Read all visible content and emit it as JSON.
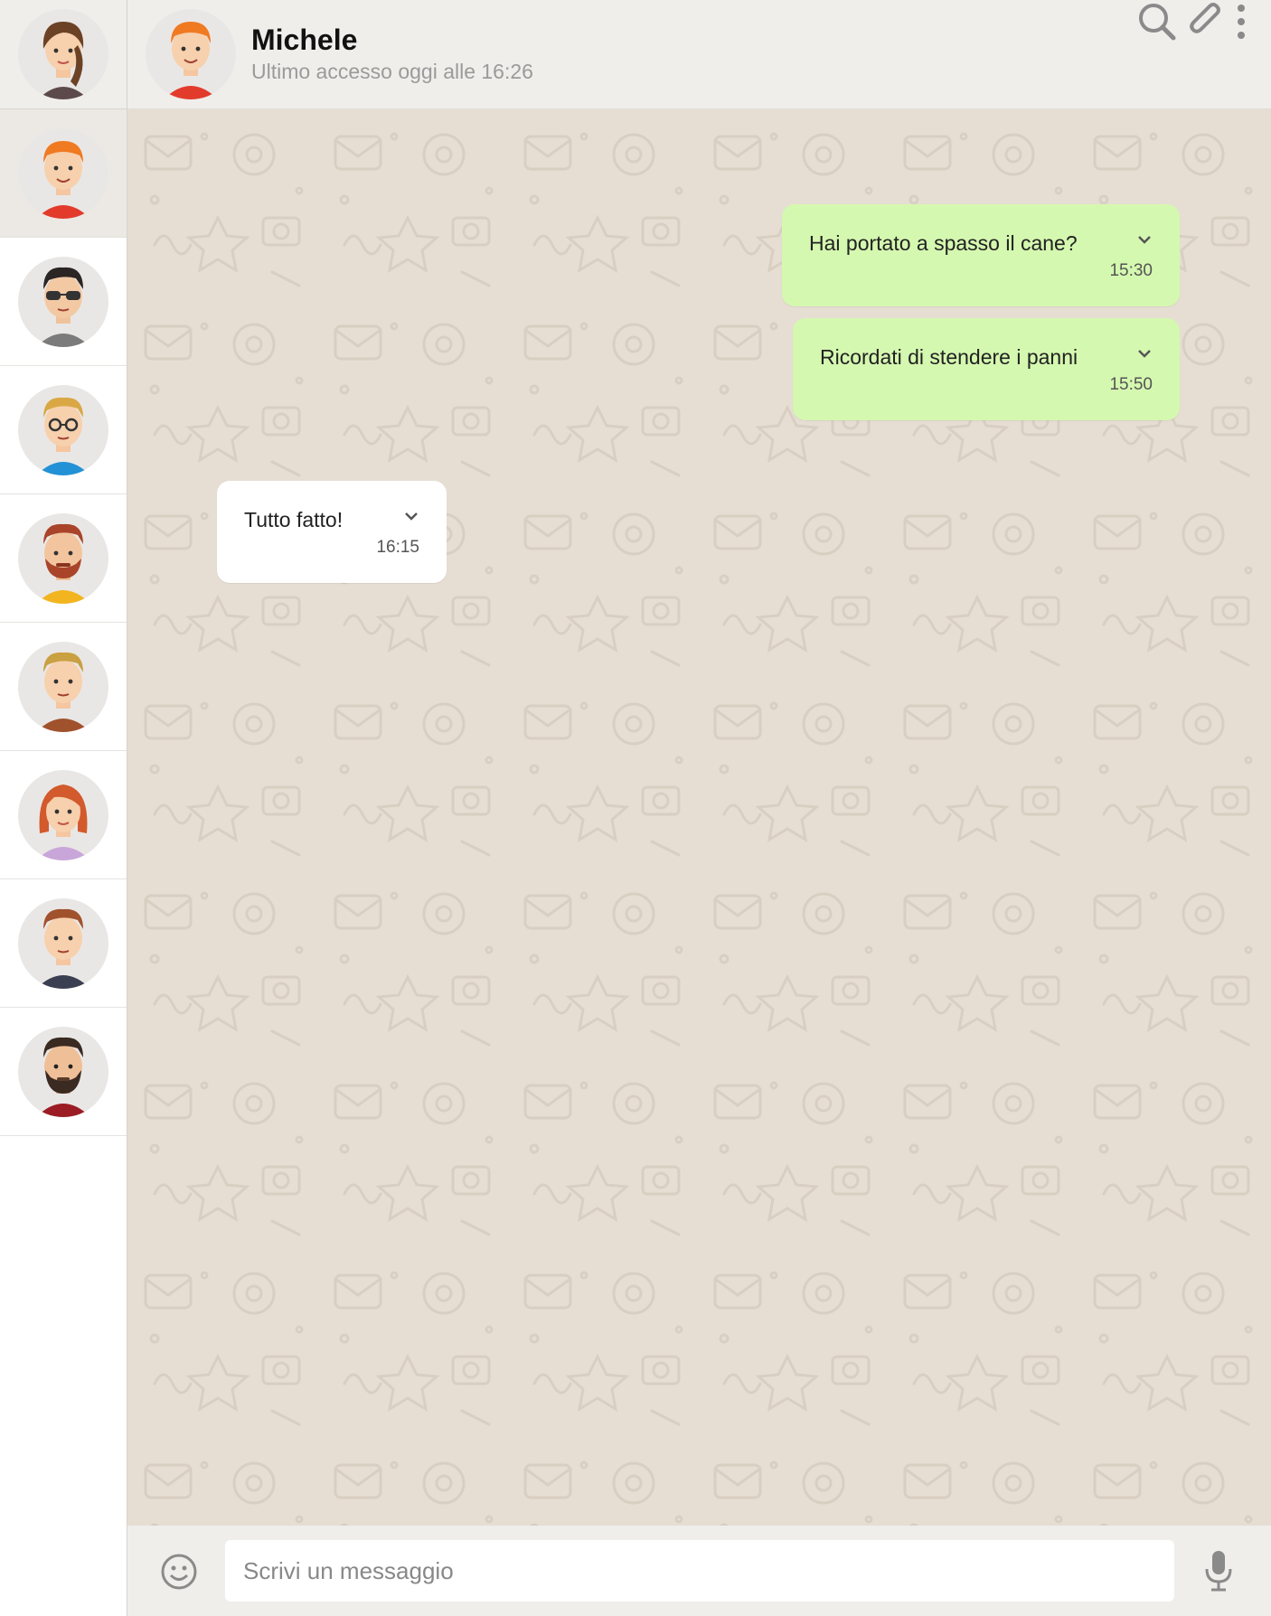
{
  "header": {
    "contact_name": "Michele",
    "last_seen": "Ultimo accesso oggi alle 16:26",
    "icons": [
      "search-icon",
      "paperclip-icon",
      "more-vertical-icon"
    ]
  },
  "sidebar": {
    "me_avatar": "avatar-woman-brown-hair",
    "contacts": [
      {
        "avatar": "avatar-redhead-man",
        "active": true
      },
      {
        "avatar": "avatar-man-sunglasses"
      },
      {
        "avatar": "avatar-man-glasses"
      },
      {
        "avatar": "avatar-man-beard-red"
      },
      {
        "avatar": "avatar-man-blond"
      },
      {
        "avatar": "avatar-woman-red-hair"
      },
      {
        "avatar": "avatar-man-brown-hair"
      },
      {
        "avatar": "avatar-man-dark-beard"
      }
    ]
  },
  "messages": [
    {
      "direction": "sent",
      "text": "Hai portato a spasso il cane?",
      "time": "15:30"
    },
    {
      "direction": "sent",
      "text": "Ricordati di stendere i panni",
      "time": "15:50"
    },
    {
      "direction": "received",
      "text": "Tutto fatto!",
      "time": "16:15"
    }
  ],
  "composer": {
    "placeholder": "Scrivi un messaggio",
    "value": ""
  },
  "colors": {
    "sent_bubble": "#d5f8b0",
    "received_bubble": "#ffffff",
    "chat_background": "#e6ded3",
    "panel": "#f0eeeb"
  }
}
